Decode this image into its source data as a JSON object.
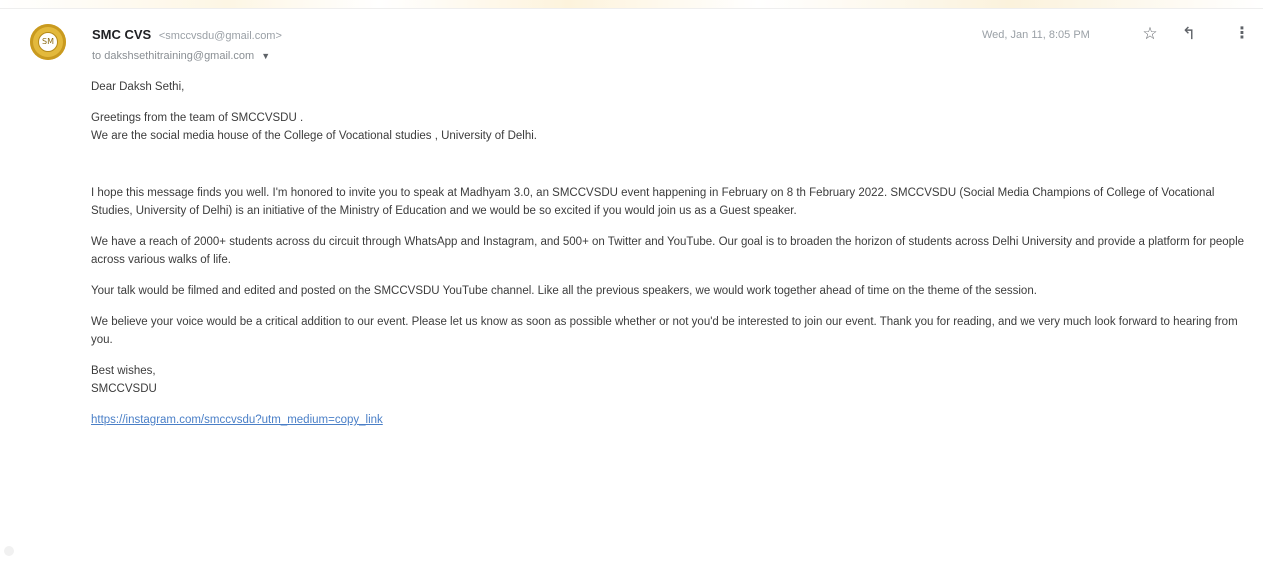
{
  "email": {
    "sender_name": "SMC CVS",
    "sender_email": "<smccvsdu@gmail.com>",
    "to_line": "to dakshsethitraining@gmail.com",
    "date": "Wed, Jan 11, 8:05 PM",
    "avatar_text": "SM",
    "body": {
      "greeting": "Dear Daksh Sethi,",
      "intro_line1": "Greetings from the team of SMCCVSDU .",
      "intro_line2": "We are the social media house of the College of Vocational studies , University of Delhi.",
      "para1": "I hope this message finds you well. I'm honored to invite you to speak at Madhyam 3.0, an SMCCVSDU event happening in February on 8 th February 2022. SMCCVSDU (Social Media Champions of College of Vocational Studies, University of Delhi) is an initiative of the Ministry of Education and we would be so excited if you would join us as a Guest speaker.",
      "para2": "We have a reach of 2000+ students across du circuit through WhatsApp and Instagram, and 500+ on Twitter and YouTube. Our goal is to broaden the horizon of students across Delhi University and provide a platform for people across various walks of life.",
      "para3": "Your talk would be filmed and edited and posted on the SMCCVSDU YouTube channel. Like all the previous speakers, we would work together ahead of time on the theme of the session.",
      "para4": "We believe your voice would be a critical addition to our event. Please let us know as soon as possible whether or not you'd be interested to join our event. Thank you for reading, and we very much look forward to hearing from you.",
      "signoff": "Best wishes,",
      "signature": "SMCCVSDU",
      "link": "https://instagram.com/smccvsdu?utm_medium=copy_link"
    }
  },
  "icons": {
    "star": "star-icon",
    "reply": "reply-icon",
    "more": "more-vert-icon",
    "caret": "caret-down-icon"
  },
  "colors": {
    "avatar_gold": "#e3b93c",
    "link_blue": "#4a7fc7"
  }
}
